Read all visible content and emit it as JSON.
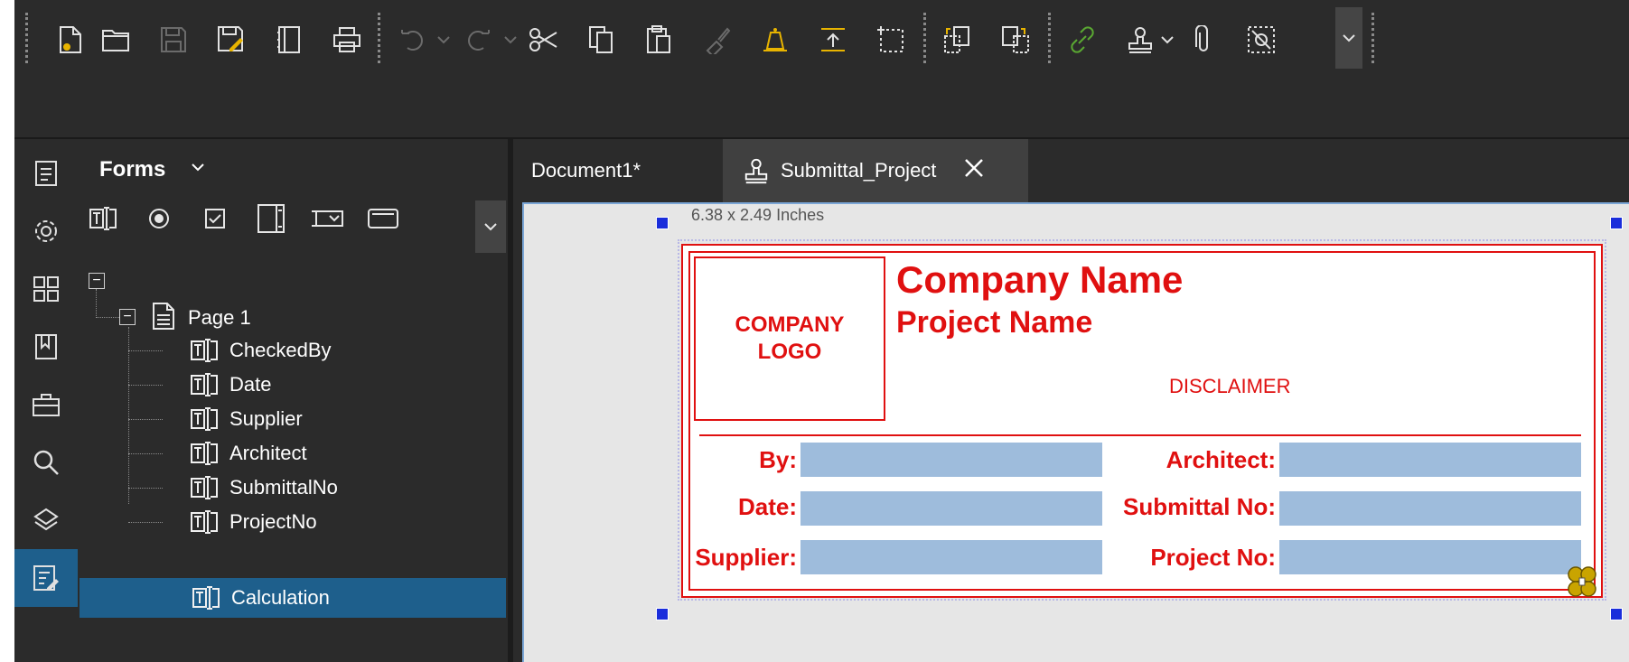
{
  "toolbar": {
    "icons": [
      "new-document-icon",
      "open-folder-icon",
      "save-icon",
      "save-as-icon",
      "notes-icon",
      "print-icon",
      "undo-icon",
      "redo-icon",
      "cut-icon",
      "copy-icon",
      "paste-icon",
      "format-painter-icon",
      "alert-bell-icon",
      "import-icon",
      "crop-icon",
      "extract-pages-icon",
      "insert-pages-icon",
      "link-icon",
      "stamp-icon",
      "attachment-icon",
      "hide-markup-icon"
    ]
  },
  "rail": {
    "items": [
      "markups-list-icon",
      "settings-gear-icon",
      "thumbnails-icon",
      "bookmarks-icon",
      "tool-chest-icon",
      "search-icon",
      "layers-icon",
      "forms-icon"
    ]
  },
  "forms_panel": {
    "title": "Forms",
    "tools": [
      "text-field-tool-icon",
      "radio-button-tool-icon",
      "checkbox-tool-icon",
      "list-box-tool-icon",
      "dropdown-tool-icon",
      "button-tool-icon"
    ],
    "tree": {
      "page_label": "Page 1",
      "fields": [
        "CheckedBy",
        "Date",
        "Supplier",
        "Architect",
        "SubmittalNo",
        "ProjectNo",
        "Calculation"
      ],
      "selected_field": "Calculation"
    }
  },
  "tabs": [
    {
      "label": "Document1*"
    },
    {
      "label": "Submittal_Project"
    }
  ],
  "canvas": {
    "dimensions_label": "6.38 x 2.49 Inches",
    "stamp": {
      "logo_line1": "COMPANY",
      "logo_line2": "LOGO",
      "company_name": "Company Name",
      "project_name": "Project Name",
      "disclaimer": "DISCLAIMER",
      "fields_left": [
        "By:",
        "Date:",
        "Supplier:"
      ],
      "fields_right": [
        "Architect:",
        "Submittal No:",
        "Project No:"
      ]
    }
  },
  "colors": {
    "accent": "#1e5f8c",
    "stamp_red": "#e01010",
    "field_fill": "#9ebcdc"
  }
}
